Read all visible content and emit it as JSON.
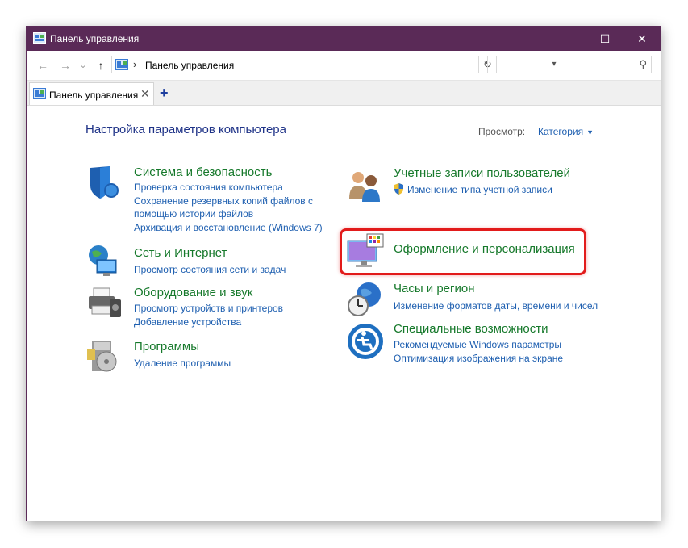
{
  "window": {
    "title": "Панель управления",
    "controls": {
      "minimize": "—",
      "maximize": "☐",
      "close": "✕"
    }
  },
  "address": {
    "breadcrumb_sep": "›",
    "breadcrumb": "Панель управления",
    "dropdown": "▾",
    "refresh": "↻",
    "search_placeholder": "",
    "search_icon": "⚲"
  },
  "nav": {
    "back": "←",
    "forward": "→",
    "recent": "⌄",
    "up": "↑"
  },
  "tabs": [
    {
      "label": "Панель управления",
      "close": "✕"
    }
  ],
  "new_tab": "+",
  "main": {
    "heading": "Настройка параметров компьютера",
    "view_label": "Просмотр:",
    "view_value": "Категория",
    "view_caret": "▼"
  },
  "categories_left": [
    {
      "title": "Система и безопасность",
      "links": [
        "Проверка состояния компьютера",
        "Сохранение резервных копий файлов с",
        "помощью истории файлов",
        "Архивация и восстановление (Windows 7)"
      ],
      "icon": "shield-icon"
    },
    {
      "title": "Сеть и Интернет",
      "links": [
        "Просмотр состояния сети и задач"
      ],
      "icon": "network-globe-icon"
    },
    {
      "title": "Оборудование и звук",
      "links": [
        "Просмотр устройств и принтеров",
        "Добавление устройства"
      ],
      "icon": "printer-icon"
    },
    {
      "title": "Программы",
      "links": [
        "Удаление программы"
      ],
      "icon": "programs-disc-icon"
    }
  ],
  "categories_right": [
    {
      "title": "Учетные записи пользователей",
      "links": [
        "Изменение типа учетной записи"
      ],
      "icon": "users-icon"
    },
    {
      "title": "Оформление и персонализация",
      "links": [],
      "icon": "monitor-palette-icon"
    },
    {
      "title": "Часы и регион",
      "links": [
        "Изменение форматов даты, времени и чисел"
      ],
      "icon": "clock-globe-icon"
    },
    {
      "title": "Специальные возможности",
      "links": [
        "Рекомендуемые Windows параметры",
        "Оптимизация изображения на экране"
      ],
      "icon": "accessibility-icon"
    }
  ],
  "colors": {
    "titlebar": "#5a2a57",
    "category_title": "#16792b",
    "link": "#1e5fb0",
    "heading": "#1e3287",
    "highlight": "#e21b1b"
  }
}
